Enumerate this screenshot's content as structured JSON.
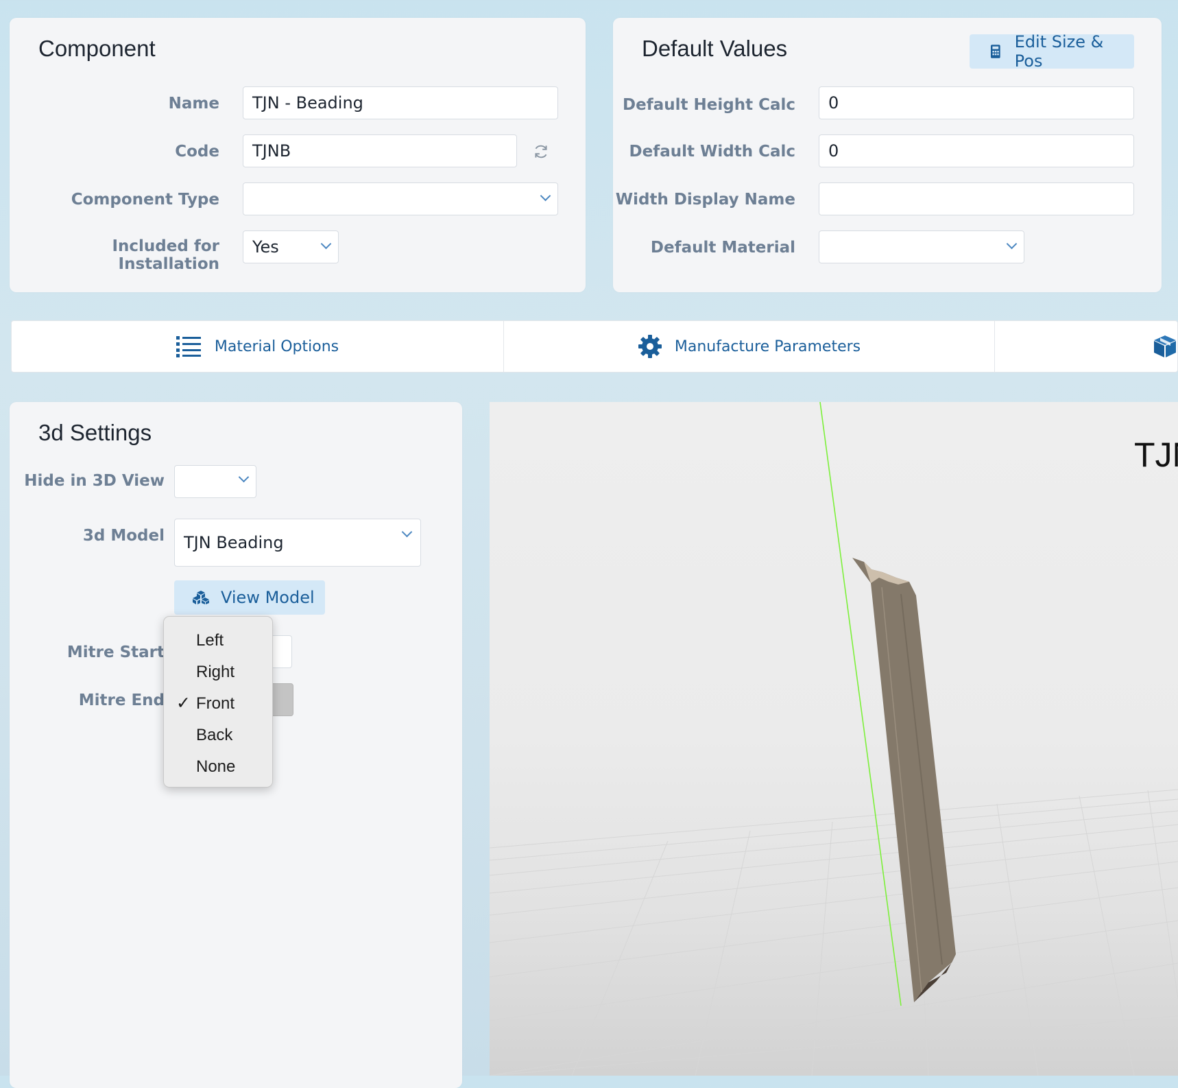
{
  "component": {
    "title": "Component",
    "name_label": "Name",
    "name_value": "TJN - Beading",
    "code_label": "Code",
    "code_value": "TJNB",
    "type_label": "Component Type",
    "type_value": "",
    "installation_label": "Included for Installation",
    "installation_value": "Yes"
  },
  "defaults": {
    "title": "Default Values",
    "edit_button": "Edit Size & Pos",
    "height_label": "Default Height Calc",
    "height_value": "0",
    "width_label": "Default Width Calc",
    "width_value": "0",
    "width_display_label": "Width Display Name",
    "width_display_value": "",
    "material_label": "Default Material",
    "material_value": ""
  },
  "tabs": [
    {
      "label": "Material Options",
      "icon": "list-icon"
    },
    {
      "label": "Manufacture Parameters",
      "icon": "gear-icon"
    },
    {
      "label": "",
      "icon": "cube-icon"
    }
  ],
  "settings3d": {
    "title": "3d Settings",
    "hide_label": "Hide in 3D View",
    "hide_value": "",
    "model_label": "3d Model",
    "model_value": "TJN Beading",
    "view_button": "View Model",
    "mitre_start_label": "Mitre Start",
    "mitre_end_label": "Mitre End"
  },
  "mitre_menu": {
    "options": [
      "Left",
      "Right",
      "Front",
      "Back",
      "None"
    ],
    "selected": "Front"
  },
  "viewport": {
    "overlay_text": "TJN",
    "line_color": "#7cf03a",
    "model_color": "#84796a"
  }
}
